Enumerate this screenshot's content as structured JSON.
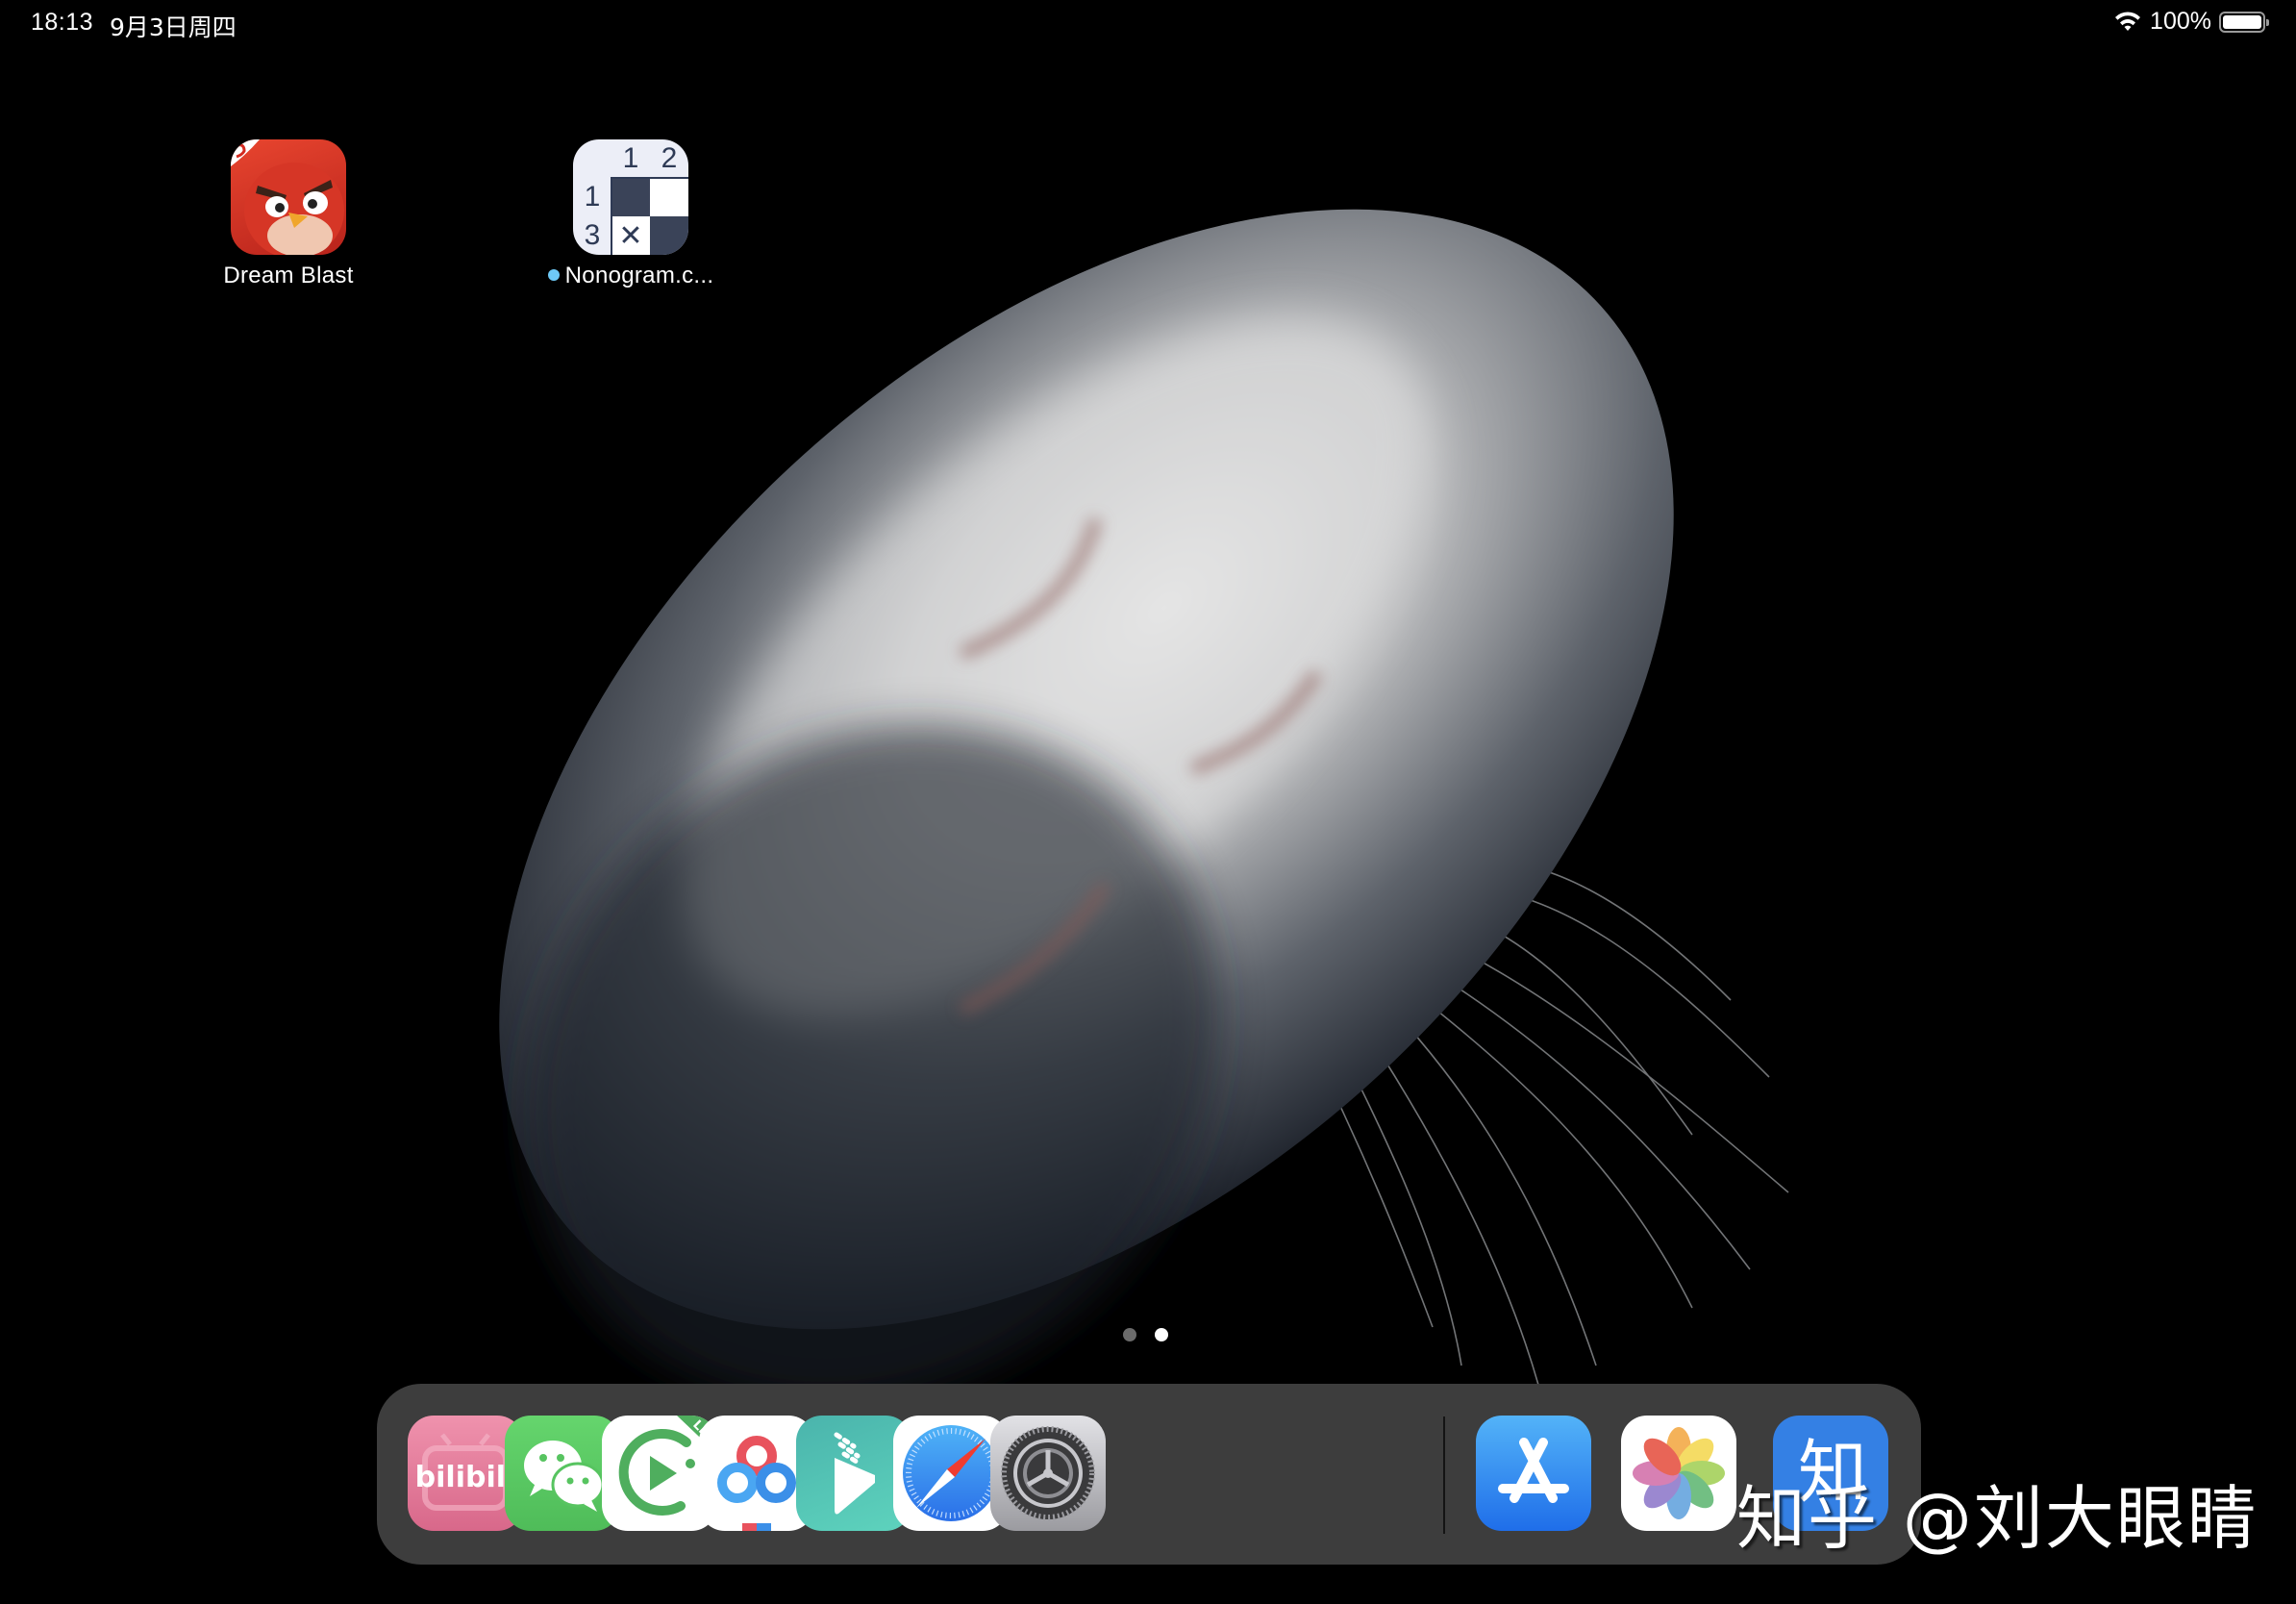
{
  "status_bar": {
    "time": "18:13",
    "date": "9月3日周四",
    "wifi_icon": "wifi-icon",
    "battery_percent": "100%",
    "battery_level": 1.0
  },
  "home_screen": {
    "apps": [
      {
        "name": "Dream Blast",
        "icon": "angry-bird-icon",
        "new_indicator": false
      },
      {
        "name": "Nonogram.c...",
        "icon": "nonogram-grid-icon",
        "new_indicator": true,
        "indicator_color": "#6ec9f6",
        "grid": {
          "col_clues": [
            "1",
            "2"
          ],
          "row_clues": [
            "1",
            "3"
          ],
          "cross_mark": "✕"
        }
      }
    ]
  },
  "page_indicator": {
    "total": 2,
    "current": 2
  },
  "dock": {
    "apps": [
      {
        "name": "bilibili",
        "icon": "bilibili-icon",
        "text": "bilibili",
        "color": "#e07a98"
      },
      {
        "name": "WeChat",
        "icon": "wechat-icon",
        "color": "#5ac361"
      },
      {
        "name": "Video Player Lite",
        "icon": "video-play-icon",
        "badge": "Lite",
        "color": "#4fae5e"
      },
      {
        "name": "Baidu Netdisk",
        "icon": "baidu-cloud-icon",
        "color": "#3a8ee6"
      },
      {
        "name": "Reader",
        "icon": "book-icon",
        "color": "#4fc2b0"
      },
      {
        "name": "Safari",
        "icon": "compass-icon",
        "color": "#2f87f0"
      },
      {
        "name": "Settings",
        "icon": "gear-icon",
        "color": "#8e8e93"
      }
    ],
    "recent_apps": [
      {
        "name": "App Store",
        "icon": "app-store-icon",
        "color": "#1e8cf5"
      },
      {
        "name": "Photos",
        "icon": "photos-flower-icon"
      },
      {
        "name": "Zhihu",
        "icon": "zhihu-icon",
        "text": "知",
        "color": "#3480e4"
      }
    ]
  },
  "watermark": "知乎 @刘大眼睛"
}
